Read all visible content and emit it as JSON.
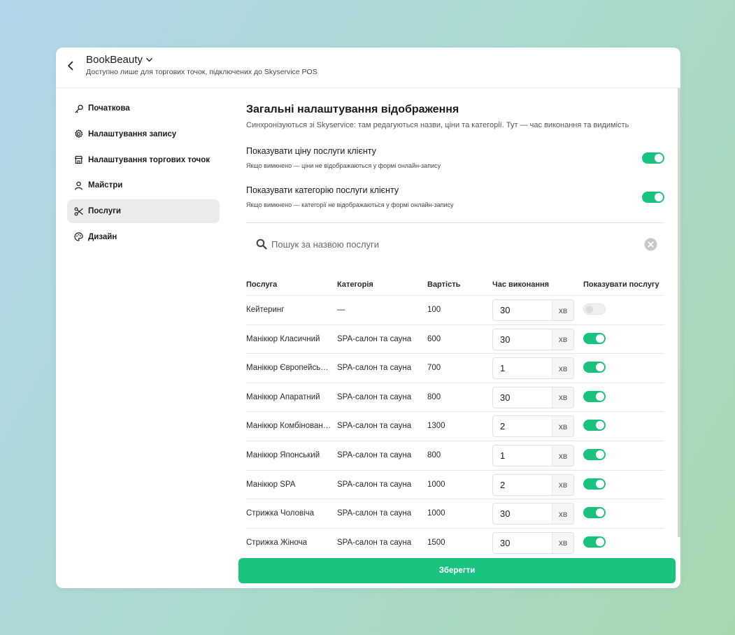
{
  "header": {
    "title": "BookBeauty",
    "subtitle": "Доступно лише для торгових точок, підключених до Skyservice POS"
  },
  "sidebar": {
    "items": [
      {
        "label": "Початкова",
        "icon": "key-icon",
        "name": "sidebar-item-home",
        "active": false
      },
      {
        "label": "Налаштування запису",
        "icon": "gear-icon",
        "name": "sidebar-item-booking-settings",
        "active": false
      },
      {
        "label": "Налаштування торгових точок",
        "icon": "store-icon",
        "name": "sidebar-item-outlets",
        "active": false
      },
      {
        "label": "Майстри",
        "icon": "user-icon",
        "name": "sidebar-item-masters",
        "active": false
      },
      {
        "label": "Послуги",
        "icon": "scissors-icon",
        "name": "sidebar-item-services",
        "active": true
      },
      {
        "label": "Дизайн",
        "icon": "palette-icon",
        "name": "sidebar-item-design",
        "active": false
      }
    ]
  },
  "main": {
    "title": "Загальні налаштування відображення",
    "subtitle": "Синхронізуються зі Skyservice: там редагуються назви, ціни та категорії. Тут — час виконання та видимість",
    "settings": [
      {
        "label": "Показувати ціну послуги клієнту",
        "hint": "Якщо вимкнено — ціни не відображаються у формі онлайн-запису",
        "enabled": true
      },
      {
        "label": "Показувати категорію послуги клієнту",
        "hint": "Якщо вимкнено — категорії не відображаються у формі онлайн-запису",
        "enabled": true
      }
    ],
    "search": {
      "placeholder": "Пошук за назвою послуги",
      "value": ""
    },
    "table": {
      "headers": {
        "service": "Послуга",
        "category": "Категорія",
        "price": "Вартість",
        "time": "Час виконання",
        "visible": "Показувати послугу"
      },
      "unit": "хв",
      "rows": [
        {
          "service": "Кейтеринг",
          "category": "—",
          "price": "100",
          "time": "30",
          "visible": false
        },
        {
          "service": "Манікюр Класичний",
          "category": "SPA-салон та сауна",
          "price": "600",
          "time": "30",
          "visible": true
        },
        {
          "service": "Манікюр Європейський",
          "category": "SPA-салон та сауна",
          "price": "700",
          "time": "1",
          "visible": true
        },
        {
          "service": "Манікюр Апаратний",
          "category": "SPA-салон та сауна",
          "price": "800",
          "time": "30",
          "visible": true
        },
        {
          "service": "Манікюр Комбінований",
          "category": "SPA-салон та сауна",
          "price": "1300",
          "time": "2",
          "visible": true
        },
        {
          "service": "Манікюр Японський",
          "category": "SPA-салон та сауна",
          "price": "800",
          "time": "1",
          "visible": true
        },
        {
          "service": "Манікюр SPA",
          "category": "SPA-салон та сауна",
          "price": "1000",
          "time": "2",
          "visible": true
        },
        {
          "service": "Стрижка Чоловіча",
          "category": "SPA-салон та сауна",
          "price": "1000",
          "time": "30",
          "visible": true
        },
        {
          "service": "Стрижка Жіноча",
          "category": "SPA-салон та сауна",
          "price": "1500",
          "time": "30",
          "visible": true
        }
      ]
    },
    "save_label": "Зберегти"
  },
  "colors": {
    "accent": "#19c37d",
    "active_bg": "#ebebeb"
  }
}
